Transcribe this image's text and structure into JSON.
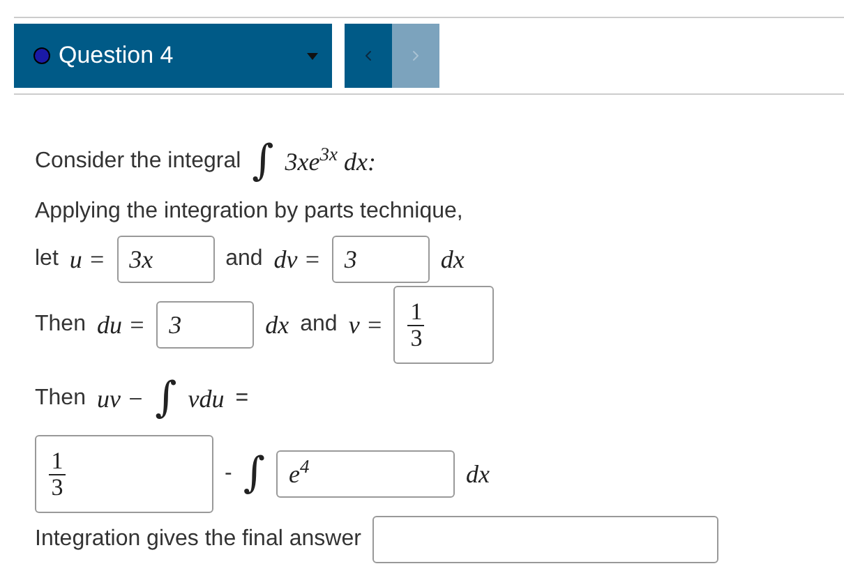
{
  "question_selector": {
    "label": "Question 4",
    "color": "#1a1aa6"
  },
  "nav": [
    {
      "kind": "prev",
      "disabled": false
    },
    {
      "kind": "next",
      "disabled": true
    }
  ],
  "lines": [
    {
      "segments": [
        {
          "kind": "text",
          "text": "Consider the integral"
        },
        {
          "kind": "integral",
          "text": "∫"
        },
        {
          "kind": "math",
          "text": "3xe$^{3x}$ dx:"
        }
      ]
    },
    {
      "segments": [
        {
          "kind": "text",
          "text": "Applying the integration by parts technique,"
        }
      ]
    },
    {
      "segments": [
        {
          "kind": "text",
          "text": "let"
        },
        {
          "kind": "math",
          "text": "u ="
        },
        {
          "kind": "field",
          "value": "3x"
        },
        {
          "kind": "text",
          "text": "and"
        },
        {
          "kind": "math",
          "text": "dv ="
        },
        {
          "kind": "field",
          "value": "3"
        },
        {
          "kind": "math",
          "text": "dx"
        }
      ]
    },
    {
      "segments": [
        {
          "kind": "text",
          "text": "Then"
        },
        {
          "kind": "math",
          "text": "du ="
        },
        {
          "kind": "field",
          "value": "3"
        },
        {
          "kind": "math",
          "text": "dx"
        },
        {
          "kind": "text",
          "text": "and"
        },
        {
          "kind": "math",
          "text": "v ="
        },
        {
          "kind": "fraction_field",
          "numerator": "1",
          "denominator": "3"
        }
      ]
    },
    {
      "segments": [
        {
          "kind": "text",
          "text": "Then"
        },
        {
          "kind": "math",
          "text": "uv −"
        },
        {
          "kind": "integral",
          "text": "∫"
        },
        {
          "kind": "math",
          "text": "vdu"
        },
        {
          "kind": "text",
          "text": "="
        }
      ]
    },
    {
      "segments": [
        {
          "kind": "fraction_field",
          "numerator": "1",
          "denominator": "3"
        },
        {
          "kind": "text",
          "text": "-"
        },
        {
          "kind": "integral",
          "text": "∫"
        },
        {
          "kind": "field",
          "value": "e$^{4}$"
        },
        {
          "kind": "math",
          "text": "dx"
        }
      ]
    },
    {
      "segments": [
        {
          "kind": "text",
          "text": "Integration gives the final answer"
        },
        {
          "kind": "field"
        }
      ]
    }
  ]
}
